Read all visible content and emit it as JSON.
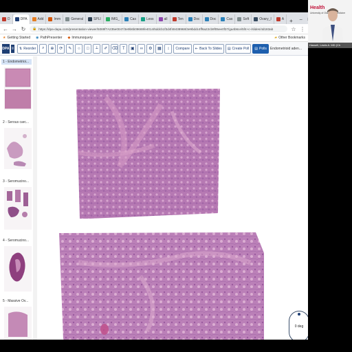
{
  "browser": {
    "tabs": [
      {
        "label": "D",
        "color": "#c0392b",
        "active": false
      },
      {
        "label": "DPA",
        "color": "#1e3e73",
        "active": true
      },
      {
        "label": "Add",
        "color": "#e67e22",
        "active": false
      },
      {
        "label": "Imm",
        "color": "#d35400",
        "active": false
      },
      {
        "label": "General",
        "color": "#7f8c8d",
        "active": false
      },
      {
        "label": "SPLI",
        "color": "#2c3e50",
        "active": false
      },
      {
        "label": "IMG_",
        "color": "#27ae60",
        "active": false
      },
      {
        "label": "Cas",
        "color": "#2980b9",
        "active": false
      },
      {
        "label": "Less",
        "color": "#16a085",
        "active": false
      },
      {
        "label": "all",
        "color": "#8e44ad",
        "active": false
      },
      {
        "label": "Ten",
        "color": "#c0392b",
        "active": false
      },
      {
        "label": "Doc",
        "color": "#2980b9",
        "active": false
      },
      {
        "label": "Doc",
        "color": "#2980b9",
        "active": false
      },
      {
        "label": "Cas",
        "color": "#2980b9",
        "active": false
      },
      {
        "label": "Soft",
        "color": "#7f8c8d",
        "active": false
      },
      {
        "label": "Ovary_I",
        "color": "#34495e",
        "active": false
      },
      {
        "label": "A",
        "color": "#c0392b",
        "active": false
      }
    ],
    "new_tab": "+",
    "url": "https://dpa-dapa.com/presentation-viewer/5089f7A235e0047/3e9b6b09669fe4014/5ddcb1f3d4f48438968/3e9bddc4ff6a22cb9f05ee0f37/ga4b6ce/5f4+c-/slides/4d183ab",
    "bookmarks": [
      "Getting Started",
      "PathPresenter",
      "Immunoquery"
    ],
    "other_bookmarks": "Other Bookmarks"
  },
  "toolbar": {
    "logo": "DPA",
    "reorder": "Reorder",
    "compare": "Compare",
    "back_to_slides": "Back To Slides",
    "create_poll": "Create Poll",
    "polls": "Polls",
    "slide_name": "Endometrioid aden...",
    "icons": [
      "search-icon",
      "zoom-icon",
      "rotate-icon",
      "pen-icon",
      "circle-icon",
      "square-icon",
      "ruler-icon",
      "pencil-icon",
      "eraser-icon",
      "text-icon",
      "image-icon",
      "link-icon",
      "settings-icon",
      "grid-icon",
      "arrow-icon"
    ]
  },
  "sidebar": {
    "items": [
      {
        "label": "1 - Endometrioi...",
        "selected": true
      },
      {
        "label": "2 - Serous carc...",
        "selected": false
      },
      {
        "label": "3 - Seromucino...",
        "selected": false
      },
      {
        "label": "4 - Seromucino...",
        "selected": false
      },
      {
        "label": "5 - Massive Ov...",
        "selected": false
      }
    ]
  },
  "viewer": {
    "rotation_readout": "0 deg"
  },
  "webcam": {
    "logo_text": "Health",
    "logo_sub": "University of Oklahoma Medicine",
    "name_plate": "Hassell, Lewis A. MD (Ch"
  }
}
